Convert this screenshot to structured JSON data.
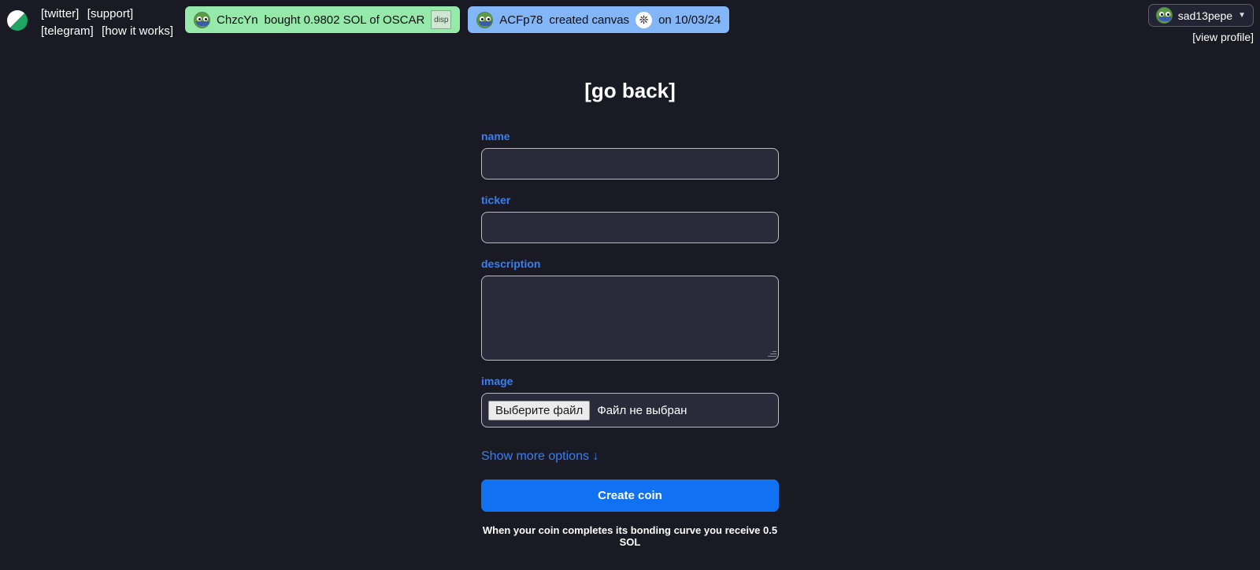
{
  "header": {
    "logo_icon": "pill-icon",
    "nav": {
      "row1": [
        {
          "label": "[twitter]",
          "name": "nav-link-twitter"
        },
        {
          "label": "[support]",
          "name": "nav-link-support"
        }
      ],
      "row2": [
        {
          "label": "[telegram]",
          "name": "nav-link-telegram"
        },
        {
          "label": "[how it works]",
          "name": "nav-link-how-it-works"
        }
      ]
    },
    "banners": [
      {
        "style": "green",
        "avatar_icon": "pepe-avatar-icon",
        "user": "ChzcYn",
        "action": "bought 0.9802 SOL of OSCAR",
        "thumb_label": "disp",
        "thumb_icon": "coin-thumbnail-icon"
      },
      {
        "style": "blue",
        "avatar_icon": "pepe-avatar-icon",
        "user": "ACFp78",
        "action": "created canvas",
        "swirl_icon": "swirl-icon",
        "date": "on 10/03/24"
      }
    ],
    "account": {
      "avatar_icon": "pepe-avatar-icon",
      "username": "sad13pepe",
      "chevron_icon": "chevron-down-icon",
      "view_profile": "[view profile]"
    }
  },
  "main": {
    "title": "[go back]",
    "fields": {
      "name": {
        "label": "name",
        "value": "",
        "placeholder": ""
      },
      "ticker": {
        "label": "ticker",
        "value": "",
        "placeholder": ""
      },
      "description": {
        "label": "description",
        "value": "",
        "placeholder": ""
      },
      "image": {
        "label": "image",
        "button_label": "Выберите файл",
        "status": "Файл не выбран"
      }
    },
    "more_options_label": "Show more options ↓",
    "submit_label": "Create coin",
    "footnote": "When your coin completes its bonding curve you receive 0.5 SOL"
  },
  "colors": {
    "background": "#191a23",
    "input_fill": "#2b2a3a",
    "accent_blue": "#1072f3",
    "label_blue": "#3a7ef0",
    "banner_green": "#95eaa9",
    "banner_blue": "#83b6f7"
  }
}
